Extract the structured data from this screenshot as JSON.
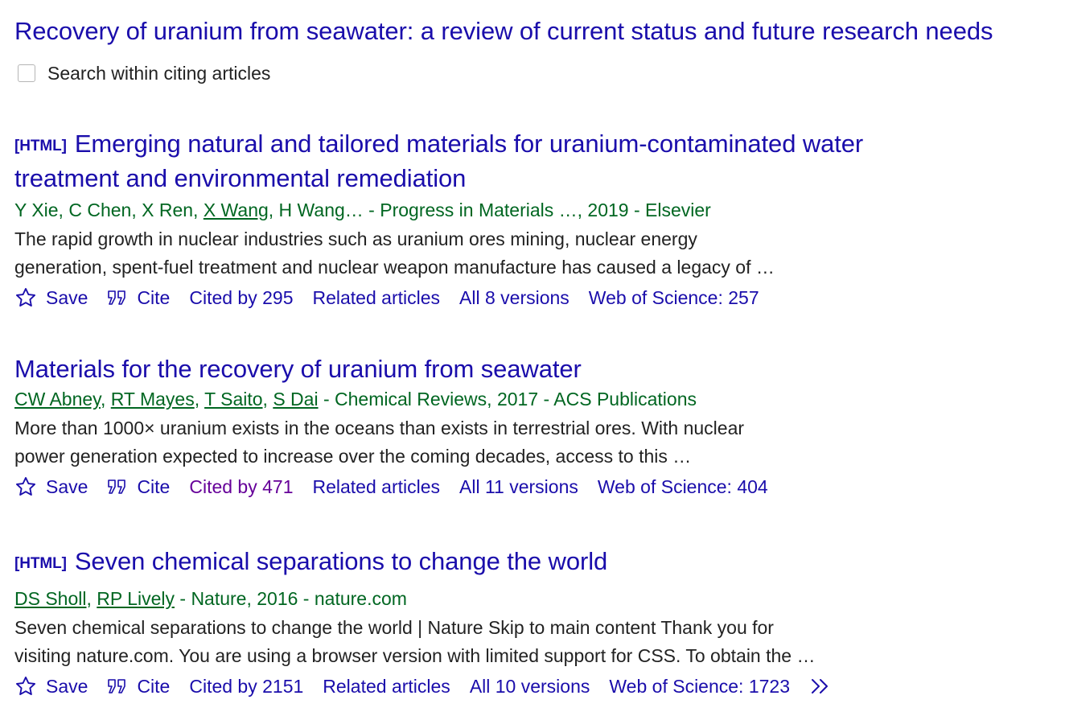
{
  "header": {
    "title": "Recovery of uranium from seawater: a review of current status and future research needs",
    "search_within_label": "Search within citing articles"
  },
  "results": [
    {
      "tag": "[HTML]",
      "title_line1": "Emerging natural and tailored materials for uranium-contaminated water",
      "title_line2": "treatment and environmental remediation",
      "authors_pre": "Y Xie, C Chen, X Ren, ",
      "author_link": "X Wang",
      "authors_post": ", H Wang… - Progress in Materials …, 2019 - Elsevier",
      "snippet_line1": "The rapid growth in nuclear industries such as uranium ores mining, nuclear energy",
      "snippet_line2": "generation, spent-fuel treatment and nuclear weapon manufacture has caused a legacy of …",
      "save": "Save",
      "cite": "Cite",
      "cited_by": "Cited by 295",
      "related": "Related articles",
      "versions": "All 8 versions",
      "wos": "Web of Science: 257"
    },
    {
      "title": "Materials for the recovery of uranium from seawater",
      "authors": [
        "CW Abney",
        "RT Mayes",
        "T Saito",
        "S Dai"
      ],
      "sep": ", ",
      "source": " - Chemical Reviews, 2017 - ACS Publications",
      "snippet_line1": "More than 1000× uranium exists in the oceans than exists in terrestrial ores. With nuclear",
      "snippet_line2": "power generation expected to increase over the coming decades, access to this …",
      "save": "Save",
      "cite": "Cite",
      "cited_by": "Cited by 471",
      "related": "Related articles",
      "versions": "All 11 versions",
      "wos": "Web of Science: 404"
    },
    {
      "tag": "[HTML]",
      "title": "Seven chemical separations to change the world",
      "authors": [
        "DS Sholl",
        "RP Lively"
      ],
      "sep": ", ",
      "source": " - Nature, 2016 - nature.com",
      "snippet_line1": "Seven chemical separations to change the world | Nature Skip to main content Thank you for",
      "snippet_line2": "visiting nature.com. You are using a browser version with limited support for CSS. To obtain the …",
      "save": "Save",
      "cite": "Cite",
      "cited_by": "Cited by 2151",
      "related": "Related articles",
      "versions": "All 10 versions",
      "wos": "Web of Science: 1723"
    }
  ],
  "colors": {
    "link": "#1a0dab",
    "visited": "#660099",
    "green": "#006621",
    "text": "#222222"
  },
  "icons": {
    "save": "star-icon",
    "cite": "quote-icon",
    "more": "double-chevron-right-icon"
  }
}
